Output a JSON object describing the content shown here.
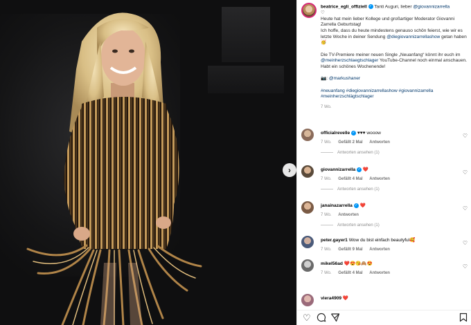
{
  "post": {
    "username": "beatrice_egli_offiziell",
    "caption_lines": [
      {
        "before": "Tanti Auguri, lieber ",
        "link": "@giovannizarrella",
        "after": ""
      },
      {
        "text": "♡"
      },
      {
        "text": "Heute hat mein lieber Kollege und großartiger Moderator Giovanni Zarrella Geburtstag!"
      },
      {
        "before": "Ich hoffe, dass du heute mindestens genauso schön feierst, wie wir es letzte Woche in deiner Sendung ",
        "link": "@diegiovannizarrellashow",
        "after": " getan haben 🥳"
      }
    ],
    "paragraph2": {
      "before": "Die TV-Premiere meiner neuen Single „Neuanfang“ könnt ihr euch im ",
      "link": "@meinherzschlaegtschlager",
      "after": " YouTube-Channel noch einmal anschauen.",
      "line2": "Habt ein schönes Wochenende!"
    },
    "credit": {
      "icon": "📷",
      "prefix": ": ",
      "link": "@markushaner"
    },
    "hashtags": "#neuanfang #diegiovannizarrellashow #giovannizarrella #meinherzschlägtschlager",
    "time": "7 Wo."
  },
  "comments": [
    {
      "user": "officialrevelle",
      "verified": true,
      "text": "♥♥♥ wooow",
      "time": "7 Wo.",
      "likes": "Gefällt 2 Mal",
      "reply": "Antworten",
      "replies": "Antworten ansehen (1)",
      "avatar_color": "#8a6b5a"
    },
    {
      "user": "giovannizarrella",
      "verified": true,
      "text": "❤️",
      "time": "7 Wo.",
      "likes": "Gefällt 4 Mal",
      "reply": "Antworten",
      "replies": "Antworten ansehen (1)",
      "avatar_color": "#5a4a3a"
    },
    {
      "user": "janainazarrella",
      "verified": true,
      "text": "❤️",
      "time": "7 Wo.",
      "likes": "",
      "reply": "Antworten",
      "replies": "Antworten ansehen (1)",
      "avatar_color": "#7a5a44"
    },
    {
      "user": "peter.gayer1",
      "verified": false,
      "text": "Wow du bist einfach beautyful🥰",
      "time": "7 Wo.",
      "likes": "Gefällt 9 Mal",
      "reply": "Antworten",
      "replies": "",
      "avatar_color": "#4a5a7a"
    },
    {
      "user": "mikel56ad",
      "verified": false,
      "text": "❤️😍😘🙈😍",
      "time": "7 Wo.",
      "likes": "Gefällt 4 Mal",
      "reply": "Antworten",
      "replies": "",
      "avatar_color": "#6a6a6a"
    },
    {
      "user": "viera4909",
      "verified": false,
      "text": "❤️",
      "time": "",
      "likes": "",
      "reply": "",
      "replies": "",
      "avatar_color": "#9a6a7a"
    }
  ],
  "icons": {
    "next": "chevron-right-icon",
    "like": "heart-icon",
    "comment": "comment-icon",
    "share": "send-icon",
    "save": "bookmark-icon"
  }
}
